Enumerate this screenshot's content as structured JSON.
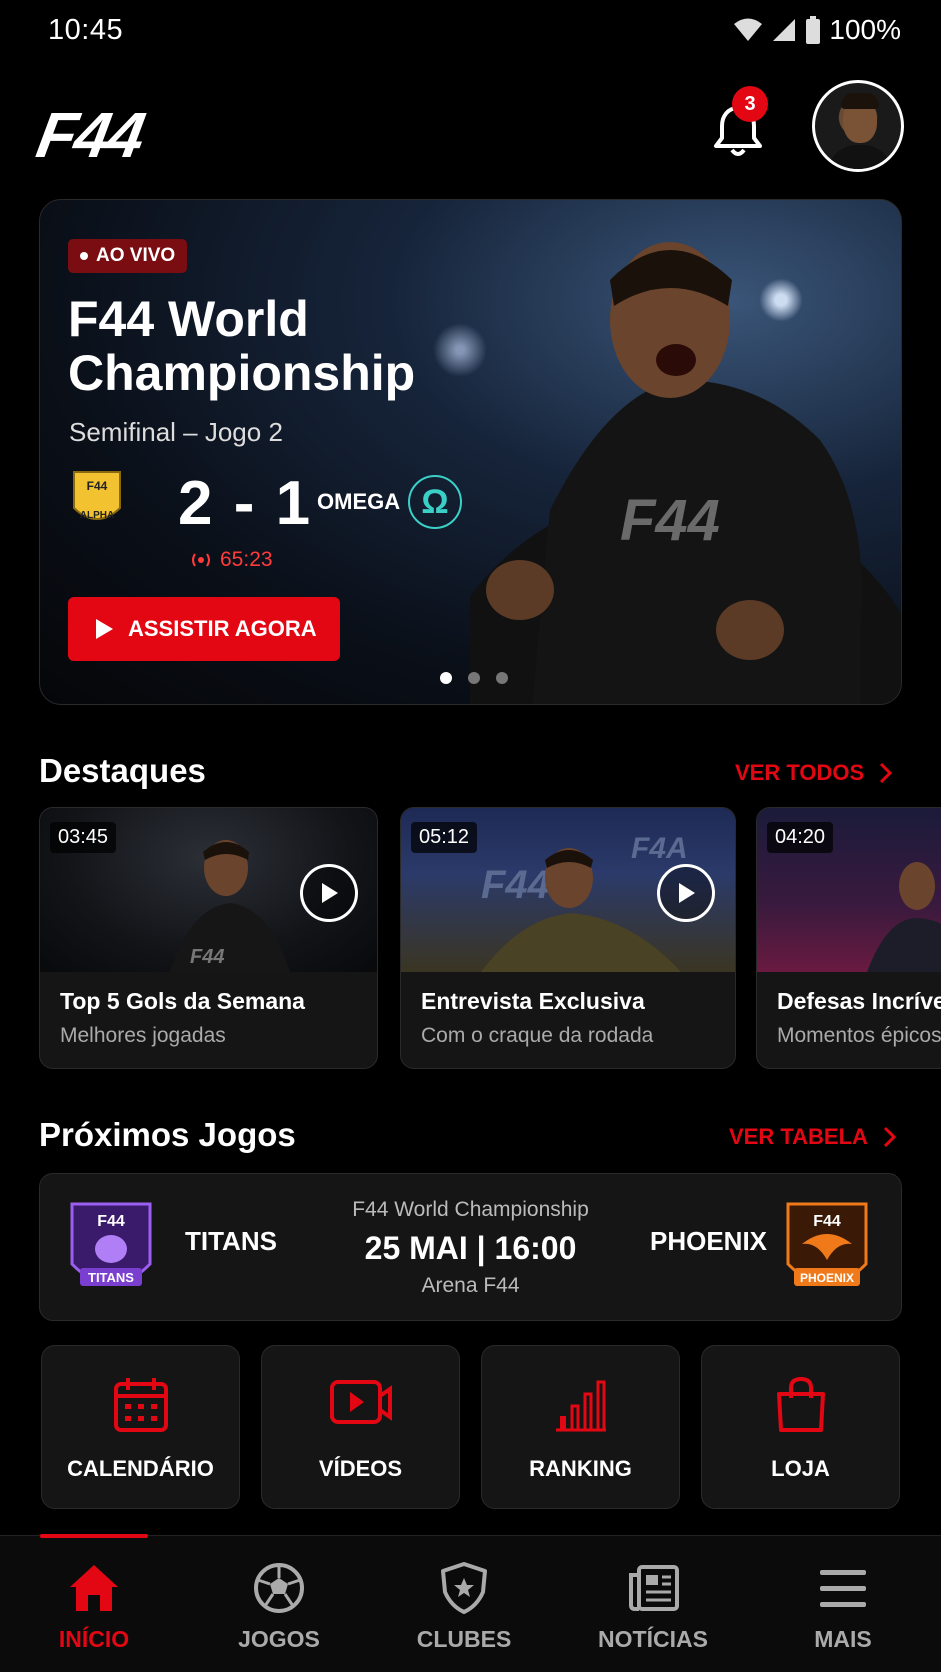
{
  "status_bar": {
    "time": "10:45",
    "battery": "100%"
  },
  "header": {
    "logo": "F44",
    "notification_count": "3"
  },
  "hero": {
    "badge": "AO VIVO",
    "title": "F44 World Championship",
    "subtitle": "Semifinal – Jogo 2",
    "team_home": "ALPHA",
    "team_home_crest_text": "F44",
    "score": "2 - 1",
    "team_away": "OMEGA",
    "team_away_symbol": "Ω",
    "live_time": "65:23",
    "watch_label": "ASSISTIR AGORA",
    "slide_count": 3,
    "active_slide": 0
  },
  "highlights": {
    "title": "Destaques",
    "see_all": "VER TODOS",
    "cards": [
      {
        "duration": "03:45",
        "title": "Top 5 Gols da Semana",
        "subtitle": "Melhores jogadas"
      },
      {
        "duration": "05:12",
        "title": "Entrevista Exclusiva",
        "subtitle": "Com o craque da rodada"
      },
      {
        "duration": "04:20",
        "title": "Defesas Incríve",
        "subtitle": "Momentos épicos"
      }
    ]
  },
  "next_games": {
    "title": "Próximos Jogos",
    "see_table": "VER TABELA",
    "match": {
      "competition": "F44 World Championship",
      "datetime": "25 MAI | 16:00",
      "venue": "Arena F44",
      "home": "TITANS",
      "away": "PHOENIX",
      "crest_text": "F44"
    }
  },
  "quick_links": [
    {
      "label": "CALENDÁRIO",
      "icon": "calendar-icon"
    },
    {
      "label": "VÍDEOS",
      "icon": "video-icon"
    },
    {
      "label": "RANKING",
      "icon": "ranking-icon"
    },
    {
      "label": "LOJA",
      "icon": "shopping-bag-icon"
    }
  ],
  "bottom_nav": [
    {
      "label": "INÍCIO",
      "icon": "home-icon",
      "active": true
    },
    {
      "label": "JOGOS",
      "icon": "soccer-ball-icon",
      "active": false
    },
    {
      "label": "CLUBES",
      "icon": "shield-icon",
      "active": false
    },
    {
      "label": "NOTÍCIAS",
      "icon": "news-icon",
      "active": false
    },
    {
      "label": "MAIS",
      "icon": "menu-icon",
      "active": false
    }
  ],
  "colors": {
    "accent": "#e30613",
    "background": "#000000",
    "card": "#151515",
    "omega": "#3ad0c8",
    "titans": "#7b3fd0",
    "phoenix": "#f07a1a",
    "alpha": "#f2c230"
  }
}
